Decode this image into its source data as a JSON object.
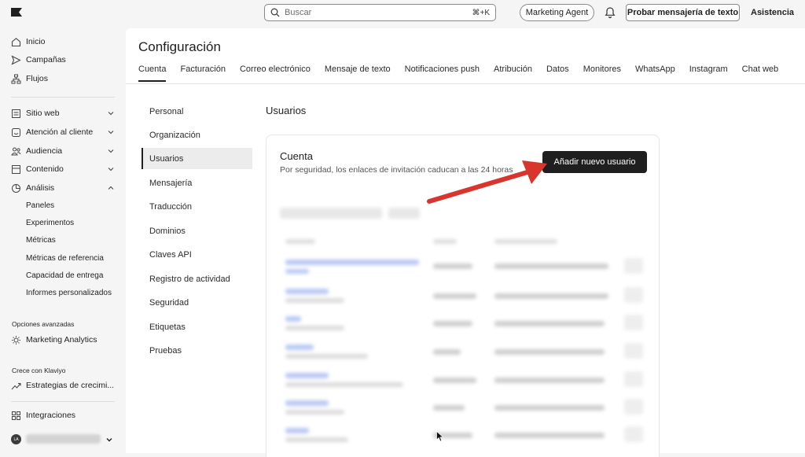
{
  "topbar": {
    "search_placeholder": "Buscar",
    "search_shortcut": "⌘+K",
    "agent_label": "Marketing Agent",
    "try_label": "Probar mensajería de texto",
    "help_label": "Asistencia"
  },
  "sidebar": {
    "items": [
      {
        "label": "Inicio",
        "icon": "home-icon"
      },
      {
        "label": "Campañas",
        "icon": "send-icon"
      },
      {
        "label": "Flujos",
        "icon": "flow-icon"
      },
      {
        "label": "Sitio web",
        "icon": "website-icon"
      },
      {
        "label": "Atención al cliente",
        "icon": "chat-icon"
      },
      {
        "label": "Audiencia",
        "icon": "audience-icon"
      },
      {
        "label": "Contenido",
        "icon": "content-icon"
      },
      {
        "label": "Análisis",
        "icon": "analytics-icon"
      }
    ],
    "analytics_subitems": [
      "Paneles",
      "Experimentos",
      "Métricas",
      "Métricas de referencia",
      "Capacidad de entrega",
      "Informes personalizados"
    ],
    "advanced_label": "Opciones avanzadas",
    "marketing_analytics": "Marketing Analytics",
    "grow_label": "Crece con Klaviyo",
    "strategies": "Estrategias de crecimi...",
    "integrations": "Integraciones",
    "avatar_initials": "LA"
  },
  "main": {
    "title": "Configuración",
    "tabs": [
      "Cuenta",
      "Facturación",
      "Correo electrónico",
      "Mensaje de texto",
      "Notificaciones push",
      "Atribución",
      "Datos",
      "Monitores",
      "WhatsApp",
      "Instagram",
      "Chat web"
    ],
    "subnav": [
      "Personal",
      "Organización",
      "Usuarios",
      "Mensajería",
      "Traducción",
      "Dominios",
      "Claves API",
      "Registro de actividad",
      "Seguridad",
      "Etiquetas",
      "Pruebas"
    ],
    "section_title": "Usuarios",
    "card": {
      "title": "Cuenta",
      "subtitle": "Por seguridad, los enlaces de invitación caducan a las 24 horas",
      "add_button": "Añadir nuevo usuario"
    }
  },
  "colors": {
    "annotation_arrow": "#d8362d",
    "primary_button": "#1f1f1f"
  }
}
